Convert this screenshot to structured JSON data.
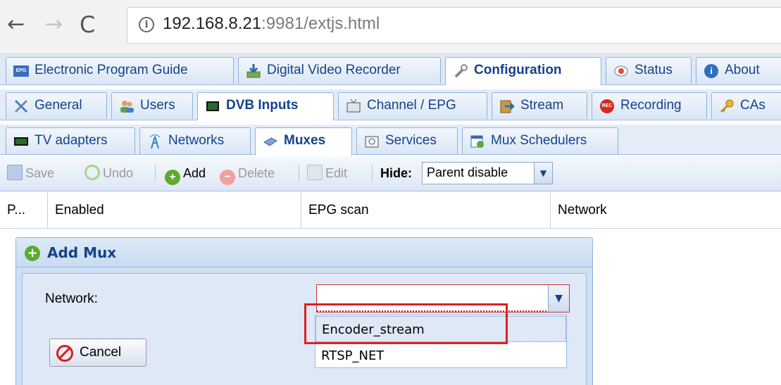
{
  "browser": {
    "back": "←",
    "forward": "→",
    "reload": "C",
    "url_host": "192.168.8.21",
    "url_rest": ":9981/extjs.html"
  },
  "main_tabs": [
    {
      "label": "Electronic Program Guide",
      "icon": "epg-icon"
    },
    {
      "label": "Digital Video Recorder",
      "icon": "download-icon"
    },
    {
      "label": "Configuration",
      "icon": "wrench-icon",
      "active": true
    },
    {
      "label": "Status",
      "icon": "eye-icon"
    },
    {
      "label": "About",
      "icon": "info-icon"
    }
  ],
  "config_tabs": [
    {
      "label": "General",
      "icon": "tools-icon"
    },
    {
      "label": "Users",
      "icon": "users-icon"
    },
    {
      "label": "DVB Inputs",
      "icon": "card-icon",
      "active": true
    },
    {
      "label": "Channel / EPG",
      "icon": "tv-icon"
    },
    {
      "label": "Stream",
      "icon": "stream-icon"
    },
    {
      "label": "Recording",
      "icon": "rec-icon"
    },
    {
      "label": "CAs",
      "icon": "key-icon"
    }
  ],
  "dvb_tabs": [
    {
      "label": "TV adapters",
      "icon": "adapter-icon"
    },
    {
      "label": "Networks",
      "icon": "antenna-icon"
    },
    {
      "label": "Muxes",
      "icon": "mux-icon",
      "active": true
    },
    {
      "label": "Services",
      "icon": "services-icon"
    },
    {
      "label": "Mux Schedulers",
      "icon": "calendar-icon"
    }
  ],
  "toolbar": {
    "save": "Save",
    "undo": "Undo",
    "add": "Add",
    "delete": "Delete",
    "edit": "Edit",
    "hide_label": "Hide:",
    "hide_value": "Parent disable"
  },
  "grid": {
    "columns": [
      "P...",
      "Enabled",
      "EPG scan",
      "Network"
    ]
  },
  "dialog": {
    "title": "Add Mux",
    "network_label": "Network:",
    "network_value": "",
    "cancel": "Cancel",
    "options": [
      "Encoder_stream",
      "RTSP_NET"
    ]
  },
  "colors": {
    "accent": "#15428b",
    "error_border": "#cc3333",
    "highlight": "#e02020"
  }
}
